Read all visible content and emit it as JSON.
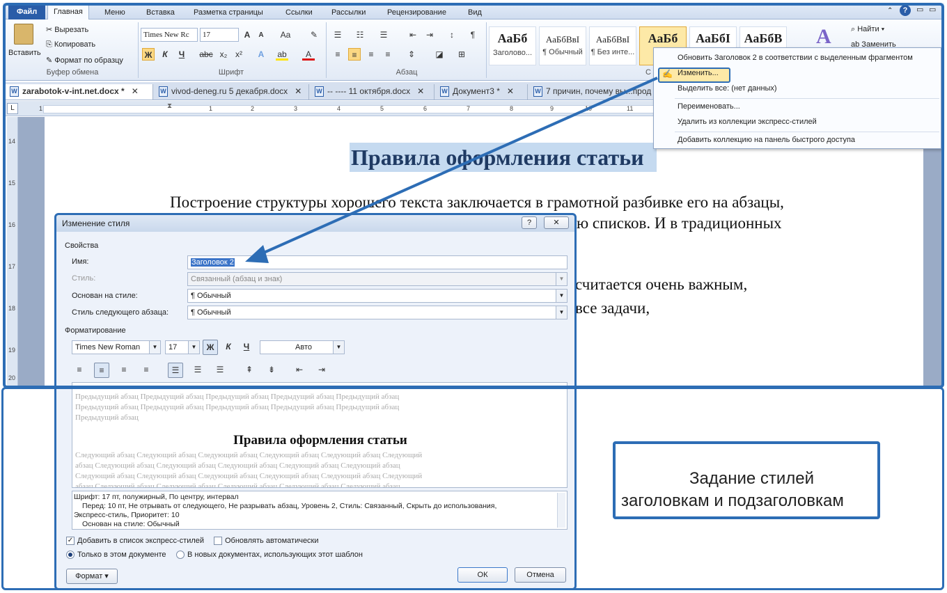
{
  "ribbon_tabs": [
    "Файл",
    "Главная",
    "Меню",
    "Вставка",
    "Разметка страницы",
    "Ссылки",
    "Рассылки",
    "Рецензирование",
    "Вид"
  ],
  "clipboard": {
    "paste": "Вставить",
    "cut": "Вырезать",
    "copy": "Копировать",
    "format_painter": "Формат по образцу",
    "label": "Буфер обмена"
  },
  "font": {
    "name": "Times New Rc",
    "size": "17",
    "label": "Шрифт",
    "bold": "Ж",
    "italic": "К",
    "underline": "Ч",
    "strike": "abc",
    "sub": "x₂",
    "sup": "x²",
    "grow": "A",
    "shrink": "A",
    "case": "Aa",
    "color": "A"
  },
  "paragraph": {
    "label": "Абзац"
  },
  "styles": {
    "items": [
      {
        "preview": "АаБб",
        "name": "Заголово..."
      },
      {
        "preview": "АаБбВвІ",
        "name": "¶ Обычный"
      },
      {
        "preview": "АаБбВвІ",
        "name": "¶ Без инте..."
      },
      {
        "preview": "АаБб",
        "name": "Заг"
      },
      {
        "preview": "АаБбІ",
        "name": ""
      },
      {
        "preview": "АаБбВ",
        "name": ""
      }
    ],
    "label": "С"
  },
  "editing": {
    "find": "Найти",
    "replace": "Заменить"
  },
  "doc_tabs": [
    {
      "name": "zarabotok-v-int.net.docx *",
      "close": "✕"
    },
    {
      "name": "vivod-deneg.ru 5 декабря.docx",
      "close": "✕"
    },
    {
      "name": "-- ---- 11 октября.docx",
      "close": "✕"
    },
    {
      "name": "Документ3 *",
      "close": "✕"
    },
    {
      "name": "7 причин, почему вы...прод",
      "close": ""
    }
  ],
  "ruler_numbers": [
    "1",
    "1",
    "2",
    "3",
    "4",
    "5",
    "6",
    "7",
    "8",
    "9",
    "10",
    "11"
  ],
  "vruler_numbers": [
    "14",
    "15",
    "16",
    "17",
    "18",
    "19",
    "20"
  ],
  "document": {
    "heading": "Правила оформления статьи",
    "line1": "Построение структуры хорошего текста заключается в грамотной разбивке его на абзацы,",
    "line2": "ю списков. И в традиционных",
    "line3": "считается очень важным,",
    "line4": "все задачи,"
  },
  "context_menu": {
    "items": [
      "Обновить Заголовок 2 в соответствии с выделенным фрагментом",
      "Изменить...",
      "Выделить все: (нет данных)",
      "Переименовать...",
      "Удалить из коллекции экспресс-стилей",
      "Добавить коллекцию на панель быстрого доступа"
    ]
  },
  "dialog": {
    "title": "Изменение стиля",
    "help": "?",
    "close": "✕",
    "properties": "Свойства",
    "name_label": "Имя:",
    "name_value": "Заголовок 2",
    "style_label": "Стиль:",
    "style_value": "Связанный (абзац и знак)",
    "based_label": "Основан на стиле:",
    "based_value": "¶  Обычный",
    "next_label": "Стиль следующего абзаца:",
    "next_value": "¶  Обычный",
    "formatting": "Форматирование",
    "font_name": "Times New Roman",
    "font_size": "17",
    "bold": "Ж",
    "italic": "К",
    "underline": "Ч",
    "color": "Авто",
    "prev_para": [
      "Предыдущий абзац Предыдущий абзац Предыдущий абзац Предыдущий абзац Предыдущий абзац",
      "Предыдущий абзац Предыдущий абзац Предыдущий абзац Предыдущий абзац Предыдущий абзац",
      "Предыдущий абзац"
    ],
    "preview_heading": "Правила оформления статьи",
    "next_para": [
      "Следующий абзац Следующий абзац Следующий абзац Следующий абзац Следующий абзац Следующий",
      "абзац Следующий абзац Следующий абзац Следующий абзац Следующий абзац Следующий абзац",
      "Следующий абзац Следующий абзац Следующий абзац Следующий абзац Следующий абзац Следующий",
      "абзац Следующий абзац Следующий абзац Следующий абзац Следующий абзац Следующий абзац"
    ],
    "desc": [
      "Шрифт: 17 пт, полужирный, По центру, интервал",
      "Перед:  10 пт, Не отрывать от следующего, Не разрывать абзац, Уровень 2, Стиль: Связанный, Скрыть до использования,",
      "Экспресс-стиль, Приоритет: 10",
      "Основан на стиле: Обычный"
    ],
    "add_quick": "Добавить в список экспресс-стилей",
    "auto_update": "Обновлять автоматически",
    "only_doc": "Только в этом документе",
    "new_docs": "В новых документах, использующих этот шаблон",
    "format_btn": "Формат ▾",
    "ok": "ОК",
    "cancel": "Отмена"
  },
  "callout": {
    "line1": "Задание стилей",
    "line2": "заголовкам и подзаголовкам"
  },
  "colors": {
    "accent": "#2d6db5",
    "ribbon": "#e2eaf6",
    "heading_bg": "#c5daf0"
  }
}
